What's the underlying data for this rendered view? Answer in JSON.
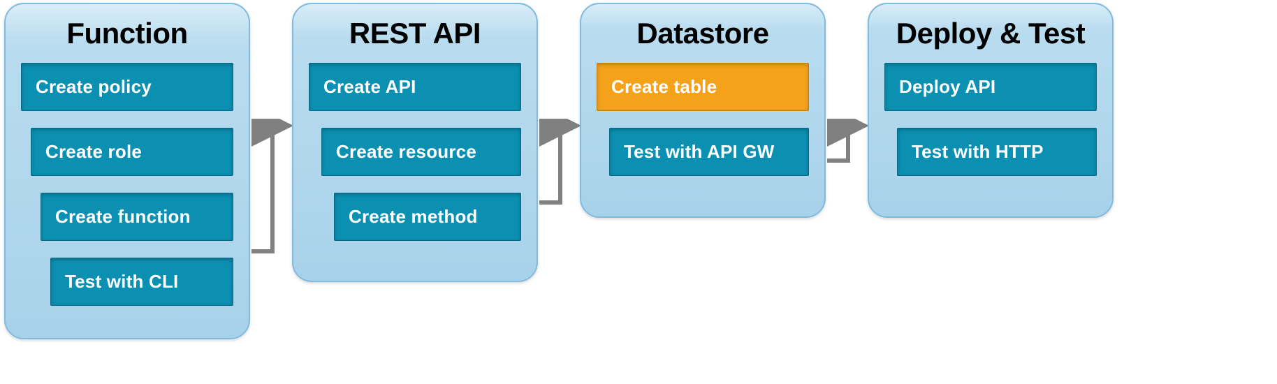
{
  "colors": {
    "step_bg": "#0c90b2",
    "step_hl_bg": "#f5a21b",
    "card_border": "#7fbbe0",
    "card_bg_top": "#d9edf7",
    "card_bg_bottom": "#a8d2ea",
    "arrow": "#808080"
  },
  "columns": [
    {
      "id": "function",
      "title": "Function",
      "steps": [
        {
          "id": "create-policy",
          "label": "Create policy",
          "highlight": false
        },
        {
          "id": "create-role",
          "label": "Create role",
          "highlight": false
        },
        {
          "id": "create-function",
          "label": "Create function",
          "highlight": false
        },
        {
          "id": "test-with-cli",
          "label": "Test with CLI",
          "highlight": false
        }
      ]
    },
    {
      "id": "rest-api",
      "title": "REST API",
      "steps": [
        {
          "id": "create-api",
          "label": "Create API",
          "highlight": false
        },
        {
          "id": "create-resource",
          "label": "Create resource",
          "highlight": false
        },
        {
          "id": "create-method",
          "label": "Create method",
          "highlight": false
        }
      ]
    },
    {
      "id": "datastore",
      "title": "Datastore",
      "steps": [
        {
          "id": "create-table",
          "label": "Create table",
          "highlight": true
        },
        {
          "id": "test-with-api-gw",
          "label": "Test with API GW",
          "highlight": false
        }
      ]
    },
    {
      "id": "deploy-test",
      "title": "Deploy & Test",
      "steps": [
        {
          "id": "deploy-api",
          "label": "Deploy API",
          "highlight": false
        },
        {
          "id": "test-with-http",
          "label": "Test with HTTP",
          "highlight": false
        }
      ]
    }
  ]
}
